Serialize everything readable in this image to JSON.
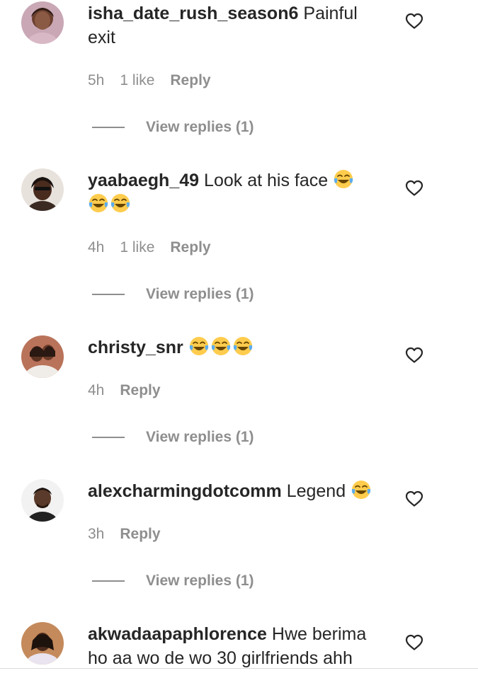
{
  "comments": [
    {
      "username": "isha_date_rush_season6",
      "text": "Painful exit",
      "emoji_count": 0,
      "line2_emoji_count": 0,
      "time": "5h",
      "likes": "1 like",
      "reply_label": "Reply",
      "view_replies": "View replies (1)"
    },
    {
      "username": "yaabaegh_49",
      "text": "Look at his face",
      "emoji_count": 1,
      "line2_emoji_count": 2,
      "time": "4h",
      "likes": "1 like",
      "reply_label": "Reply",
      "view_replies": "View replies (1)"
    },
    {
      "username": "christy_snr",
      "text": "",
      "emoji_count": 3,
      "line2_emoji_count": 0,
      "time": "4h",
      "likes": "",
      "reply_label": "Reply",
      "view_replies": "View replies (1)"
    },
    {
      "username": "alexcharmingdotcomm",
      "text": "Legend",
      "emoji_count": 1,
      "line2_emoji_count": 0,
      "time": "3h",
      "likes": "",
      "reply_label": "Reply",
      "view_replies": "View replies (1)"
    },
    {
      "username": "akwadaapaphlorence",
      "text": "Hwe berima ho aa wo de wo 30 girlfriends ahh",
      "emoji_count": 0,
      "line2_emoji_count": 0,
      "time": "",
      "likes": "",
      "reply_label": "",
      "view_replies": ""
    }
  ],
  "icons": {
    "heart": "heart-outline-icon",
    "emoji": "face-with-tears-of-joy-emoji"
  },
  "colors": {
    "text": "#262626",
    "muted": "#8e8e8e",
    "emoji_face": "#FFCC4D",
    "emoji_tears": "#5DADEC"
  }
}
